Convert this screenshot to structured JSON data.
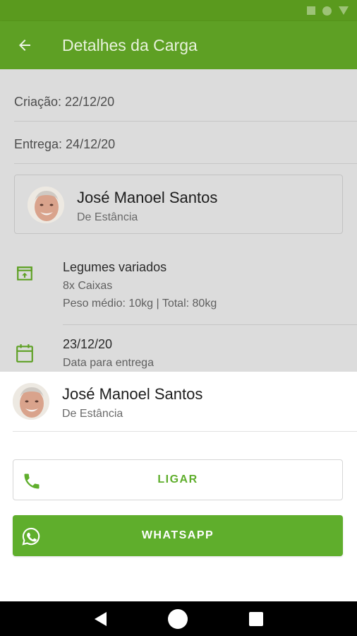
{
  "appbar": {
    "title": "Detalhes da Carga"
  },
  "dates": {
    "criacao": "Criação: 22/12/20",
    "entrega": "Entrega: 24/12/20"
  },
  "sender": {
    "name": "José Manoel Santos",
    "origin": "De Estância"
  },
  "cargo": {
    "title": "Legumes variados",
    "quantity": "8x Caixas",
    "weight": "Peso médio: 10kg | Total: 80kg"
  },
  "delivery": {
    "date": "23/12/20",
    "label": "Data para entrega"
  },
  "sheet": {
    "name": "José Manoel Santos",
    "origin": "De Estância",
    "call_label": "LIGAR",
    "whatsapp_label": "WHATSAPP"
  },
  "colors": {
    "primary": "#5ea024",
    "status_bar": "#5a9a1e",
    "button_green": "#5fae2c"
  },
  "icons": {
    "back": "arrow-left-icon",
    "cargo": "archive-box-icon",
    "calendar": "calendar-icon",
    "phone": "phone-icon",
    "whatsapp": "whatsapp-icon"
  }
}
